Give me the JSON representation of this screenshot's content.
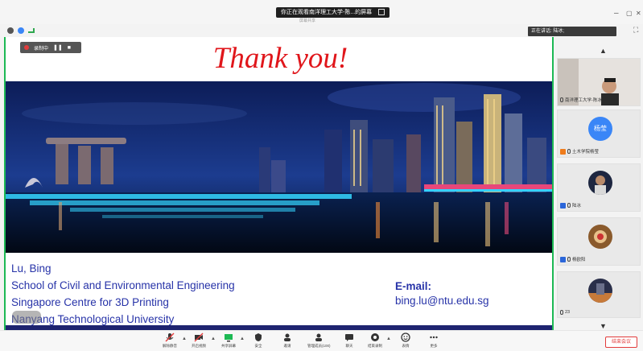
{
  "window": {
    "share_pill": "你正在观看南洋理工大学-陈...的屏幕",
    "share_sub": "屏幕共享",
    "controls": [
      "–",
      "▢",
      "✕"
    ]
  },
  "recording": {
    "label": "录制中"
  },
  "speaking": {
    "label": "正在讲话: 陆冰;"
  },
  "slide": {
    "title": "Thank you!",
    "contact_lines": [
      "Lu, Bing",
      "School of Civil and Environmental Engineering",
      "Singapore Centre for 3D Printing",
      "Nanyang Technological University"
    ],
    "email_label": "E-mail:",
    "email": "bing.lu@ntu.edu.sg"
  },
  "participants": [
    {
      "name": "南洋理工大学-陈冰",
      "kind": "video"
    },
    {
      "name": "土木学院杨莹",
      "avatar_text": "杨莹",
      "kind": "avatar",
      "badge": "orange"
    },
    {
      "name": "陆冰",
      "kind": "photo",
      "badge": "blue"
    },
    {
      "name": "杨欧阳",
      "kind": "photo",
      "badge": "blue"
    },
    {
      "name": "23",
      "kind": "photo"
    }
  ],
  "toolbar": {
    "items": [
      {
        "label": "解除静音",
        "icon": "mic-icon"
      },
      {
        "label": "开启视频",
        "icon": "camera-off-icon"
      },
      {
        "label": "共享屏幕",
        "icon": "share-screen-icon"
      },
      {
        "label": "安全",
        "icon": "shield-icon"
      },
      {
        "label": "邀请",
        "icon": "invite-icon"
      },
      {
        "label": "管理成员(100)",
        "icon": "members-icon"
      },
      {
        "label": "聊天",
        "icon": "chat-icon"
      },
      {
        "label": "结束录制",
        "icon": "record-icon"
      },
      {
        "label": "表情",
        "icon": "emoji-icon"
      },
      {
        "label": "更多",
        "icon": "more-icon"
      }
    ],
    "leave_label": "结束会议"
  },
  "colors": {
    "accent_green": "#1db954",
    "title_red": "#e0161b",
    "contact_blue": "#2733a8",
    "leave_red": "#e23b3b"
  }
}
